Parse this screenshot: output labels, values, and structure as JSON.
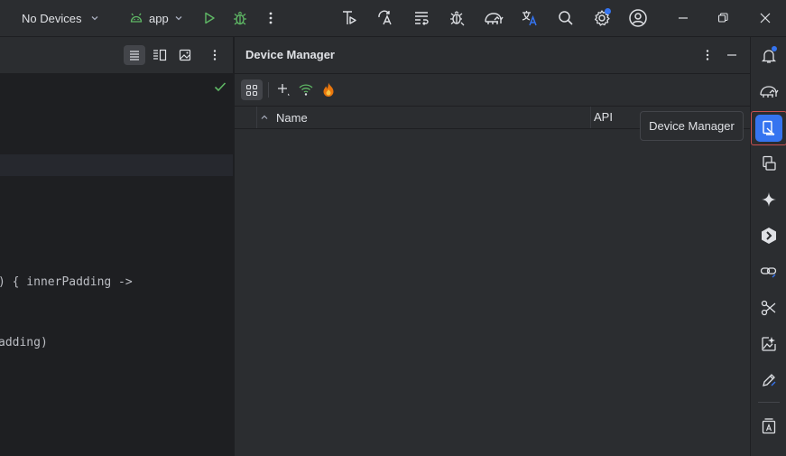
{
  "titlebar": {
    "device_selector": "No Devices",
    "run_config": "app"
  },
  "editor": {
    "code_lines": [
      ") { innerPadding ->",
      "adding)"
    ]
  },
  "device_manager": {
    "title": "Device Manager",
    "columns": [
      "Name",
      "API"
    ]
  },
  "tooltip": {
    "text": "Device Manager"
  },
  "colors": {
    "accent": "#3574f0",
    "run_green": "#5fb865",
    "highlight_border": "#c94f4f"
  }
}
